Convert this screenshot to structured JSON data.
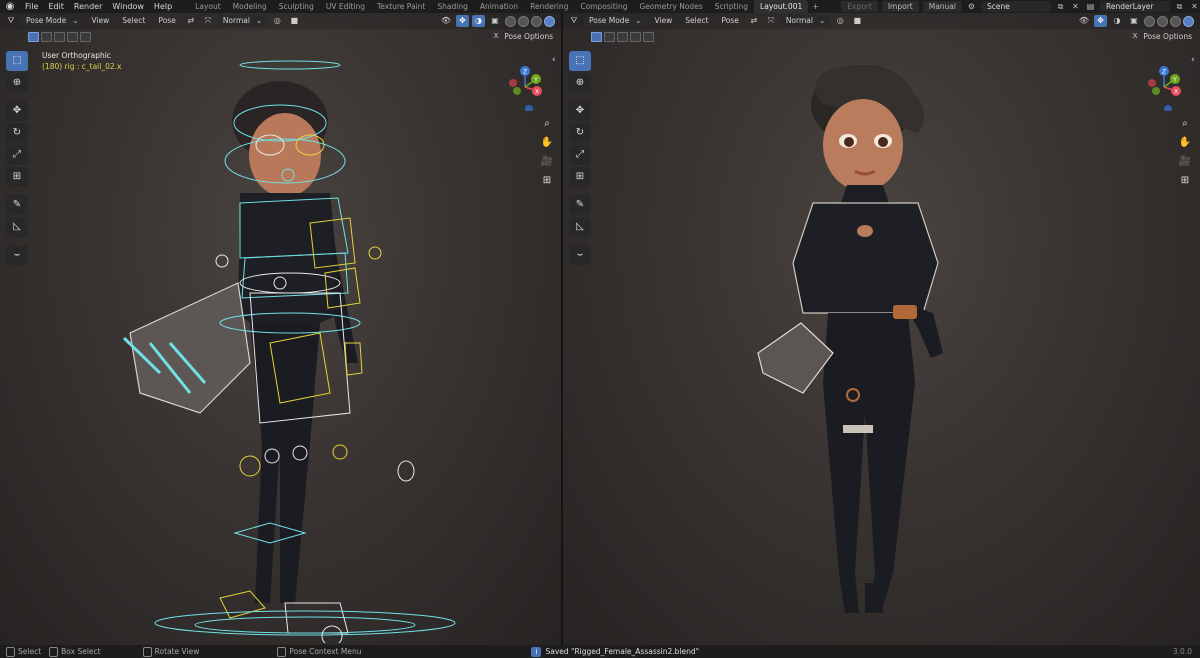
{
  "menu": {
    "items": [
      "File",
      "Edit",
      "Render",
      "Window",
      "Help"
    ]
  },
  "workspaces": {
    "tabs": [
      "Layout",
      "Modeling",
      "Sculpting",
      "UV Editing",
      "Texture Paint",
      "Shading",
      "Animation",
      "Rendering",
      "Compositing",
      "Geometry Nodes",
      "Scripting",
      "Layout.001"
    ],
    "active": "Layout.001",
    "add_label": "+"
  },
  "topright": {
    "export_label": "Export",
    "import_label": "Import",
    "manual_label": "Manual",
    "scene": "Scene",
    "render_layer": "RenderLayer"
  },
  "left_viewport": {
    "mode": "Pose Mode",
    "menus": [
      "View",
      "Select",
      "Pose"
    ],
    "pivot": "Normal",
    "view_name": "User Orthographic",
    "active_object": "(180) rig : c_tail_02.x",
    "pose_options": "Pose Options",
    "x_label": "X"
  },
  "right_viewport": {
    "mode": "Pose Mode",
    "menus": [
      "View",
      "Select",
      "Pose"
    ],
    "pivot": "Normal",
    "pose_options": "Pose Options",
    "x_label": "X"
  },
  "gizmo": {
    "x": "X",
    "y": "Y",
    "z": "Z",
    "colors": {
      "x": "#e64c5a",
      "y": "#6ea61e",
      "z": "#3a78d6",
      "neg_z": "#2f5fa8"
    }
  },
  "tools": [
    "select-box-icon",
    "cursor-icon",
    "move-icon",
    "rotate-icon",
    "scale-icon",
    "transform-icon",
    "annotate-icon",
    "measure-icon",
    "pose-relax-icon"
  ],
  "statusbar": {
    "select": "Select",
    "box_select": "Box Select",
    "rotate_view": "Rotate View",
    "context_menu": "Pose Context Menu",
    "message": "Saved \"Rigged_Female_Assassin2.blend\"",
    "version": "3.0.0"
  },
  "colors": {
    "accent": "#4772b3",
    "rig_cyan": "#6fe0e6",
    "rig_yellow": "#e6d23a",
    "header_bg": "#1d1d1d"
  }
}
